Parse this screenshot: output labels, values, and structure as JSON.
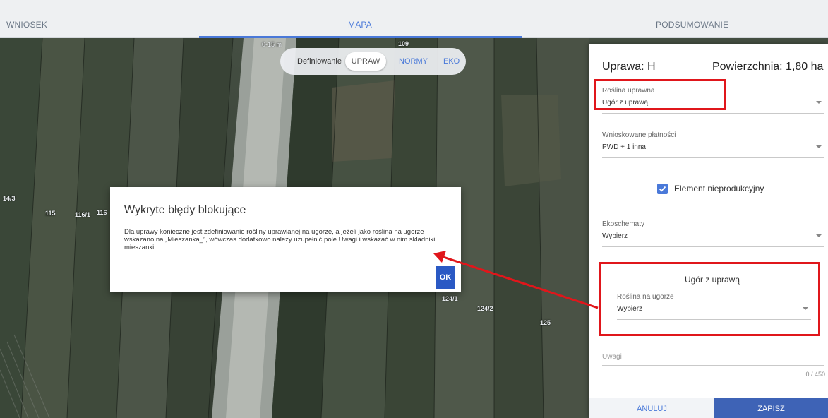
{
  "nav": {
    "tabs": [
      {
        "label": "WNIOSEK"
      },
      {
        "label": "MAPA"
      },
      {
        "label": "PODSUMOWANIE"
      }
    ]
  },
  "map": {
    "scale_label": "0-15 m",
    "parcel_labels": [
      "109",
      "14/3",
      "115",
      "116/1",
      "116",
      "124/1",
      "124/2",
      "125"
    ]
  },
  "toggle": {
    "label": "Definiowanie",
    "options": [
      "UPRAW",
      "NORMY",
      "EKO"
    ],
    "selected": "UPRAW"
  },
  "panel": {
    "title": "Uprawa: H",
    "area": "Powierzchnia: 1,80 ha",
    "fields": {
      "roslina": {
        "label": "Roślina uprawna",
        "value": "Ugór z uprawą"
      },
      "platnosci": {
        "label": "Wnioskowane płatności",
        "value": "PWD + 1 inna"
      },
      "ekoschematy": {
        "label": "Ekoschematy",
        "value": "Wybierz"
      }
    },
    "checkbox": {
      "label": "Element nieprodukcyjny",
      "checked": true
    },
    "subsection": {
      "title": "Ugór z uprawą",
      "field": {
        "label": "Roślina na ugorze",
        "value": "Wybierz"
      }
    },
    "uwagi": {
      "label": "Uwagi",
      "counter": "0 / 450"
    },
    "cancel_label": "ANULUJ",
    "save_label": "ZAPISZ"
  },
  "modal": {
    "title": "Wykryte błędy blokujące",
    "body": "Dla uprawy konieczne jest zdefiniowanie rośliny uprawianej na ugorze, a jeżeli jako roślina na ugorze wskazano na „Mieszanka_”, wówczas dodatkowo należy uzupełnić pole Uwagi i wskazać w nim składniki mieszanki",
    "ok_label": "OK"
  },
  "colors": {
    "accent": "#4a79d9",
    "save_button": "#3e63b6",
    "ok_button": "#2a59c4",
    "highlight": "#e0161b"
  }
}
